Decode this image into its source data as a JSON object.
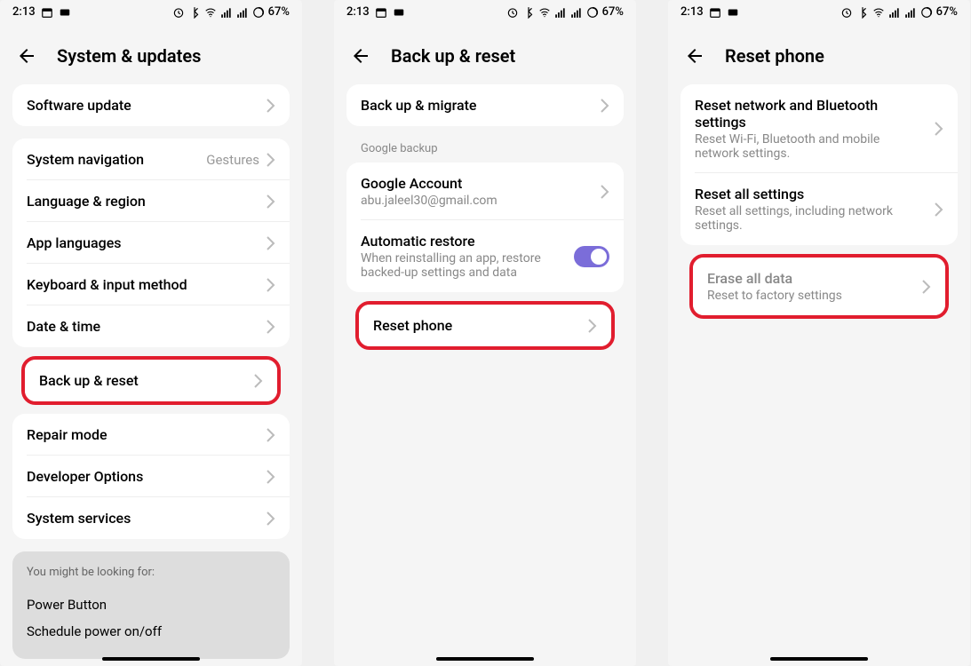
{
  "status": {
    "time": "2:13",
    "battery": "67%"
  },
  "screen1": {
    "title": "System & updates",
    "item1": "Software update",
    "nav": {
      "label": "System navigation",
      "value": "Gestures"
    },
    "lang": "Language & region",
    "applang": "App languages",
    "keyboard": "Keyboard & input method",
    "datetime": "Date & time",
    "backup": "Back up & reset",
    "repair": "Repair mode",
    "dev": "Developer Options",
    "services": "System services",
    "suggestion": {
      "title": "You might be looking for:",
      "power": "Power Button",
      "schedule": "Schedule power on/off"
    }
  },
  "screen2": {
    "title": "Back up & reset",
    "migrate": "Back up & migrate",
    "section": "Google backup",
    "account": {
      "title": "Google Account",
      "email": "abu.jaleel30@gmail.com"
    },
    "restore": {
      "title": "Automatic restore",
      "desc": "When reinstalling an app, restore backed-up settings and data"
    },
    "reset": "Reset phone"
  },
  "screen3": {
    "title": "Reset phone",
    "net": {
      "title": "Reset network and Bluetooth settings",
      "desc": "Reset Wi-Fi, Bluetooth and mobile network settings."
    },
    "all": {
      "title": "Reset all settings",
      "desc": "Reset all settings, including network settings."
    },
    "erase": {
      "title": "Erase all data",
      "desc": "Reset to factory settings"
    }
  }
}
